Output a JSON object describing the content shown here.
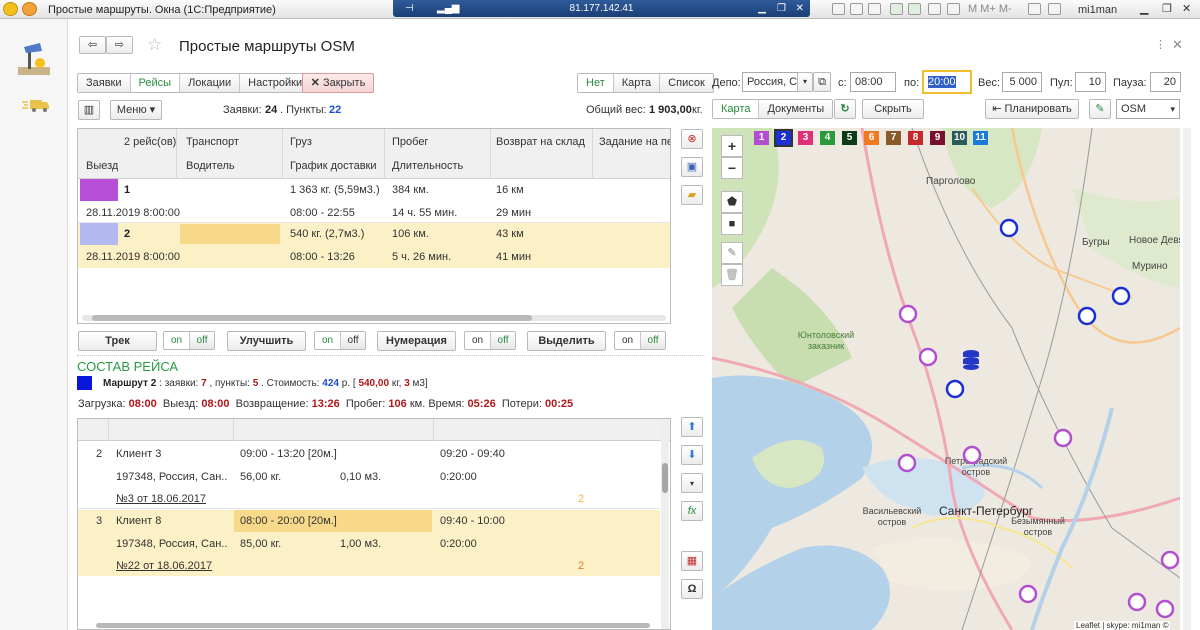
{
  "window": {
    "title": "Простые маршруты. Окна (1С:Предприятие)",
    "remote_ip": "81.177.142.41",
    "user": "mi1man",
    "tb_icons": [
      "pin-icon",
      "signal-icon",
      "minimize-icon",
      "restore-icon",
      "close-icon"
    ]
  },
  "form": {
    "title": "Простые маршруты OSM"
  },
  "tabs": [
    "Заявки",
    "Рейсы",
    "Локации",
    "Настройки"
  ],
  "close_button": "Закрыть",
  "view_toggle": [
    "Нет",
    "Карта",
    "Список"
  ],
  "depot": {
    "label": "Депо:",
    "value": "Россия, Са"
  },
  "time": {
    "from_label": "с:",
    "from": "08:00",
    "to_label": "по:",
    "to": "20:00"
  },
  "weight": {
    "label": "Вес:",
    "value": "5 000"
  },
  "pul": {
    "label": "Пул:",
    "value": "10"
  },
  "pause": {
    "label": "Пауза:",
    "value": "20"
  },
  "toolbar2": {
    "menu": "Меню",
    "requests_label": "Заявки:",
    "requests": "24",
    "points_label": ". Пункты:",
    "points": "22",
    "total_weight_label": "Общий вес:",
    "total_weight": "1 903,00",
    "total_weight_unit": "кг."
  },
  "map_tabs": [
    "Карта",
    "Документы"
  ],
  "hide_button": "Скрыть",
  "plan_button": "Планировать",
  "map_layer": "OSM",
  "trips_table": {
    "headers1": [
      "",
      "2 рейс(ов)",
      "Транспорт",
      "Груз",
      "Пробег",
      "Возврат на склад",
      "Задание на пер"
    ],
    "headers2": [
      "Выезд",
      "Водитель",
      "График доставки",
      "Длительность"
    ],
    "rows": [
      {
        "num": "1",
        "color": "#b94fd6",
        "cargo": "1 363 кг. (5,59м3.)",
        "mileage": "384 км.",
        "ret": "16 км",
        "date": "28.11.2019 8:00:00",
        "schedule": "08:00 - 22:55",
        "duration": "14 ч. 55 мин.",
        "ret_time": "29 мин"
      },
      {
        "num": "2",
        "color": "#b5b9f2",
        "cargo": "540 кг. (2,7м3.)",
        "mileage": "106 км.",
        "ret": "43 км",
        "date": "28.11.2019 8:00:00",
        "schedule": "08:00 - 13:26",
        "duration": "5 ч. 26 мин.",
        "ret_time": "41 мин"
      }
    ]
  },
  "action_bar": [
    {
      "label": "Трек",
      "on": "on",
      "off": "off"
    },
    {
      "label": "Улучшить",
      "on": "on",
      "off": "off"
    },
    {
      "label": "Нумерация",
      "on": "on",
      "off": "off"
    },
    {
      "label": "Выделить",
      "on": "on",
      "off": "off"
    }
  ],
  "trip_section": {
    "title": "СОСТАВ РЕЙСА",
    "color": "#0a16d8",
    "route_label": "Маршрут 2",
    "requests_label": ": заявки:",
    "requests": "7",
    "points_label": ", пункты:",
    "points": "5",
    "cost_label": ". Стоимость:",
    "cost": "424",
    "cost_unit": "р. [",
    "cost_sum": "540,00",
    "cost_unit2": "кг,",
    "cost_vol": "3",
    "cost_unit3": "м3]",
    "load_label": "Загрузка:",
    "load": "08:00",
    "dep_label": "Выезд:",
    "dep": "08:00",
    "ret_label": "Возвращение:",
    "ret": "13:26",
    "mil_label": "Пробег:",
    "mil": "106",
    "mil_unit": "км. Время:",
    "time": "05:26",
    "loss_label": "Потери:",
    "loss": "00:25"
  },
  "stops": [
    {
      "num": "2",
      "client": "Клиент 3",
      "window": "09:00 - 13:20 [20м.]",
      "arrive": "09:20 - 09:40",
      "addr": "197348, Россия, Сан...",
      "weight": "56,00 кг.",
      "vol": "0,10 м3.",
      "stay": "0:20:00",
      "doc": "№3 от 18.06.2017",
      "doc_num": "2"
    },
    {
      "num": "3",
      "client": "Клиент 8",
      "window": "08:00 - 20:00 [20м.]",
      "arrive": "09:40 - 10:00",
      "addr": "197348, Россия, Сан...",
      "weight": "85,00 кг.",
      "vol": "1,00 м3.",
      "stay": "0:20:00",
      "doc": "№22 от 18.06.2017",
      "doc_num": "2"
    }
  ],
  "map": {
    "route_tags": [
      {
        "n": "1",
        "c": "#b24fd0"
      },
      {
        "n": "2",
        "c": "#1a2fd8"
      },
      {
        "n": "3",
        "c": "#e0307a"
      },
      {
        "n": "4",
        "c": "#2a9a3a"
      },
      {
        "n": "5",
        "c": "#0d3b18"
      },
      {
        "n": "6",
        "c": "#f07a20"
      },
      {
        "n": "7",
        "c": "#8a5a2a"
      },
      {
        "n": "8",
        "c": "#c42828"
      },
      {
        "n": "9",
        "c": "#7a1030"
      },
      {
        "n": "10",
        "c": "#2f5a5a"
      },
      {
        "n": "11",
        "c": "#1a7ad8"
      }
    ],
    "labels": [
      "Парголово",
      "Бугры",
      "Новое Девя",
      "Мурино",
      "Юнтоловский заказник",
      "Петроградский остров",
      "Васильевский остров",
      "Санкт-Петербург",
      "Безымянный остров"
    ],
    "attribution": "Leaflet | skype: mi1man ©"
  },
  "icons": [
    "settings-icon",
    "delivery-icon",
    "back-icon",
    "forward-icon",
    "star-icon",
    "maximize-icon",
    "close-icon",
    "columns-icon",
    "delete-icon",
    "save-icon",
    "folder-icon",
    "refresh-icon",
    "pencil-icon",
    "zoom-in-icon",
    "zoom-out-icon",
    "polygon-icon",
    "square-icon",
    "edit-icon",
    "trash-icon",
    "arrow-up-icon",
    "arrow-down-icon",
    "dropdown-icon",
    "fx-icon",
    "excel-icon",
    "omega-icon",
    "storage-icon"
  ]
}
